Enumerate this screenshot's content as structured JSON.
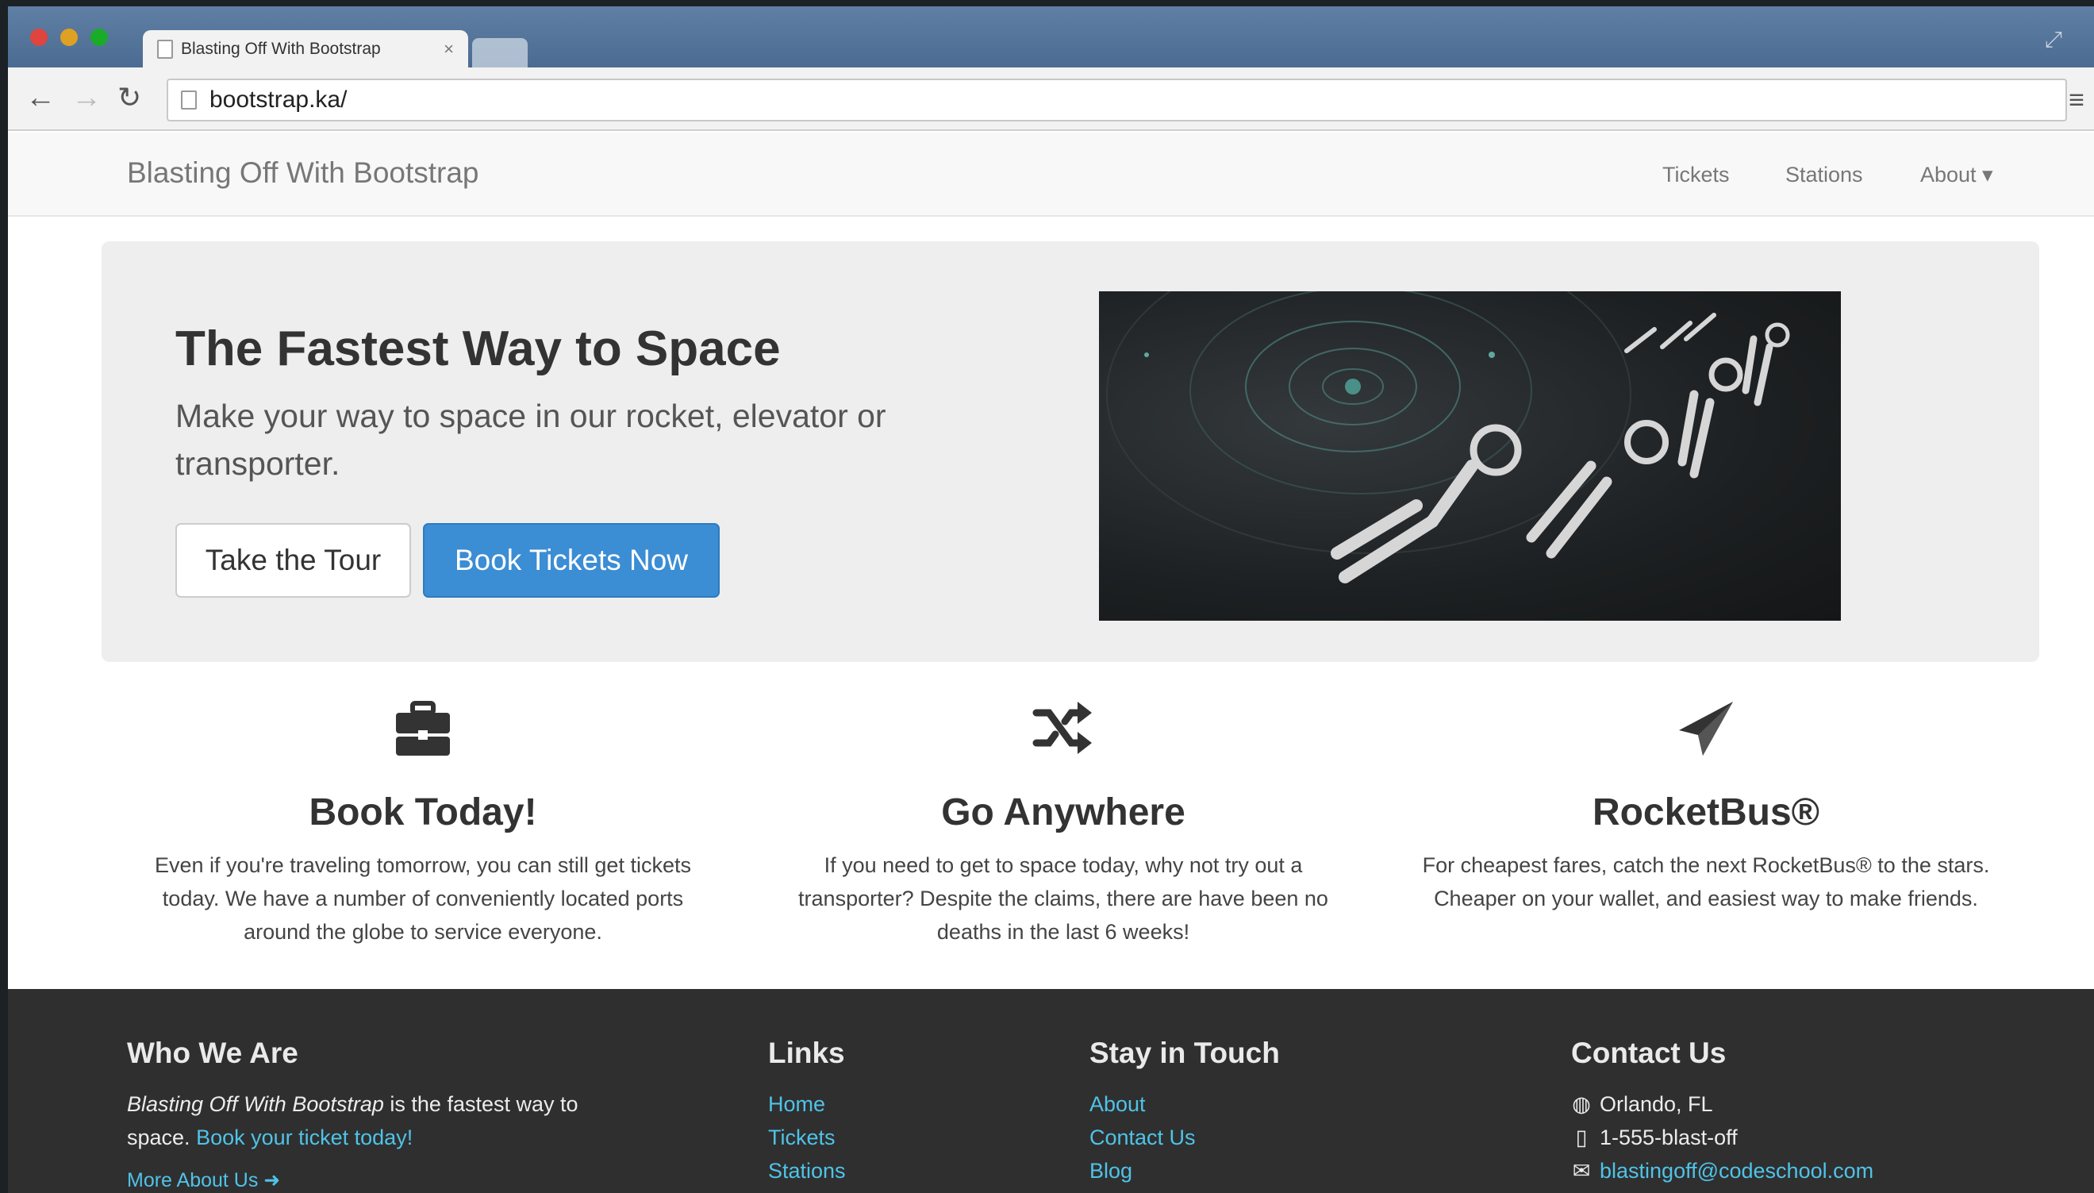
{
  "browser": {
    "tab_title": "Blasting Off With Bootstrap",
    "tab_close": "×",
    "url": "bootstrap.ka/"
  },
  "nav": {
    "brand": "Blasting Off With Bootstrap",
    "links": [
      "Tickets",
      "Stations",
      "About ▾"
    ]
  },
  "hero": {
    "title": "The Fastest Way to Space",
    "lead": "Make your way to space in our rocket, elevator or transporter.",
    "tour_button": "Take the Tour",
    "book_button": "Book Tickets Now"
  },
  "features": [
    {
      "icon": "briefcase-icon",
      "title": "Book Today!",
      "text": "Even if you're traveling tomorrow, you can still get tickets today. We have a number of conveniently located ports around the globe to service everyone."
    },
    {
      "icon": "shuffle-icon",
      "title": "Go Anywhere",
      "text": "If you need to get to space today, why not try out a transporter? Despite the claims, there are have been no deaths in the last 6 weeks!"
    },
    {
      "icon": "send-icon",
      "title": "RocketBus®",
      "text": "For cheapest fares, catch the next RocketBus® to the stars. Cheaper on your wallet, and easiest way to make friends."
    }
  ],
  "footer": {
    "who": {
      "heading": "Who We Are",
      "brand_italic": "Blasting Off With Bootstrap",
      "text": " is the fastest way to space. ",
      "link": "Book your ticket today!",
      "more": "More About Us ➜"
    },
    "links": {
      "heading": "Links",
      "items": [
        "Home",
        "Tickets",
        "Stations"
      ]
    },
    "touch": {
      "heading": "Stay in Touch",
      "items": [
        "About",
        "Contact Us",
        "Blog"
      ]
    },
    "contact": {
      "heading": "Contact Us",
      "location": "Orlando, FL",
      "phone": "1-555-blast-off",
      "email": "blastingoff@codeschool.com"
    }
  },
  "colors": {
    "primary": "#3b8dd4",
    "footer_bg": "#2f2f2f",
    "footer_link": "#4fc3e8",
    "navbar_bg": "#f8f8f8",
    "jumbotron_bg": "#eeeeee"
  }
}
